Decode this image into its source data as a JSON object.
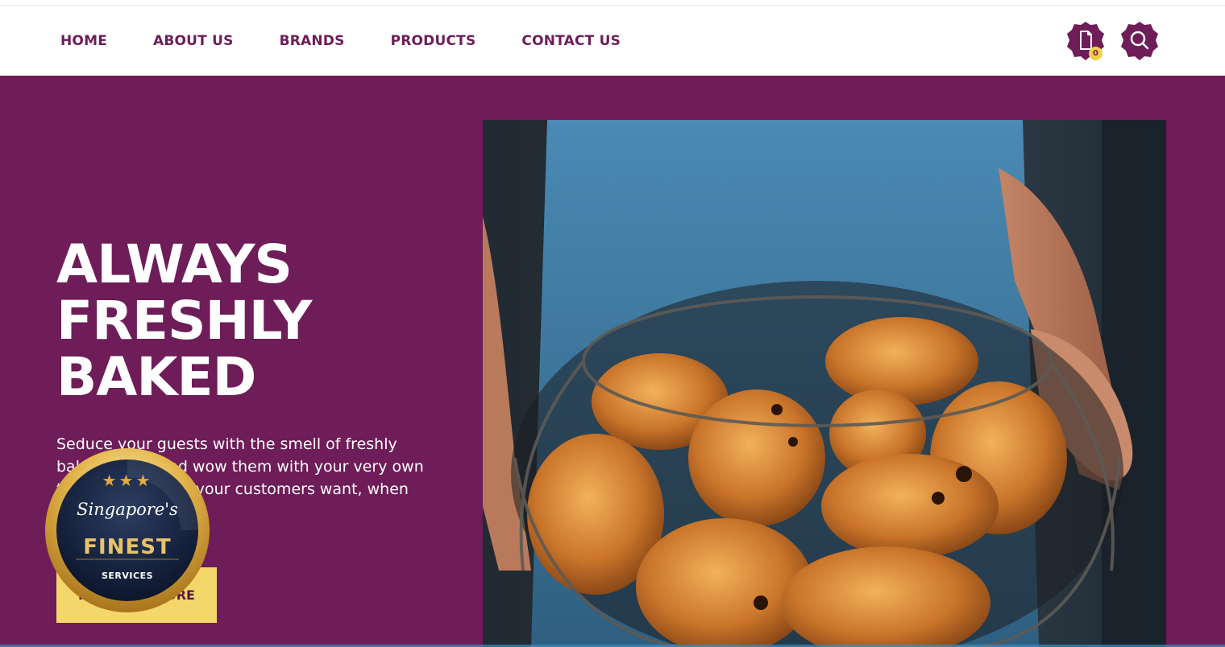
{
  "nav": {
    "links": [
      "HOME",
      "ABOUT US",
      "BRANDS",
      "PRODUCTS",
      "CONTACT US"
    ],
    "cart_count": "0"
  },
  "hero": {
    "title_lines": [
      "ALWAYS",
      "FRESHLY",
      "BAKED"
    ],
    "description": "Seduce your guests with the smell of freshly baked goods and wow them with your very own touch! Bake what your customers want, when they want it.",
    "cta_label": "FIND OUT MORE"
  },
  "badge": {
    "stars": "★★★",
    "script": "Singapore's",
    "title": "FINEST",
    "subtitle": "SERVICES"
  },
  "colors": {
    "brand_purple": "#6e1d58",
    "accent_yellow": "#f4d76a",
    "white": "#ffffff"
  },
  "icons": [
    "cart-icon",
    "search-icon",
    "croissant-basket-photo",
    "singapores-finest-badge"
  ]
}
